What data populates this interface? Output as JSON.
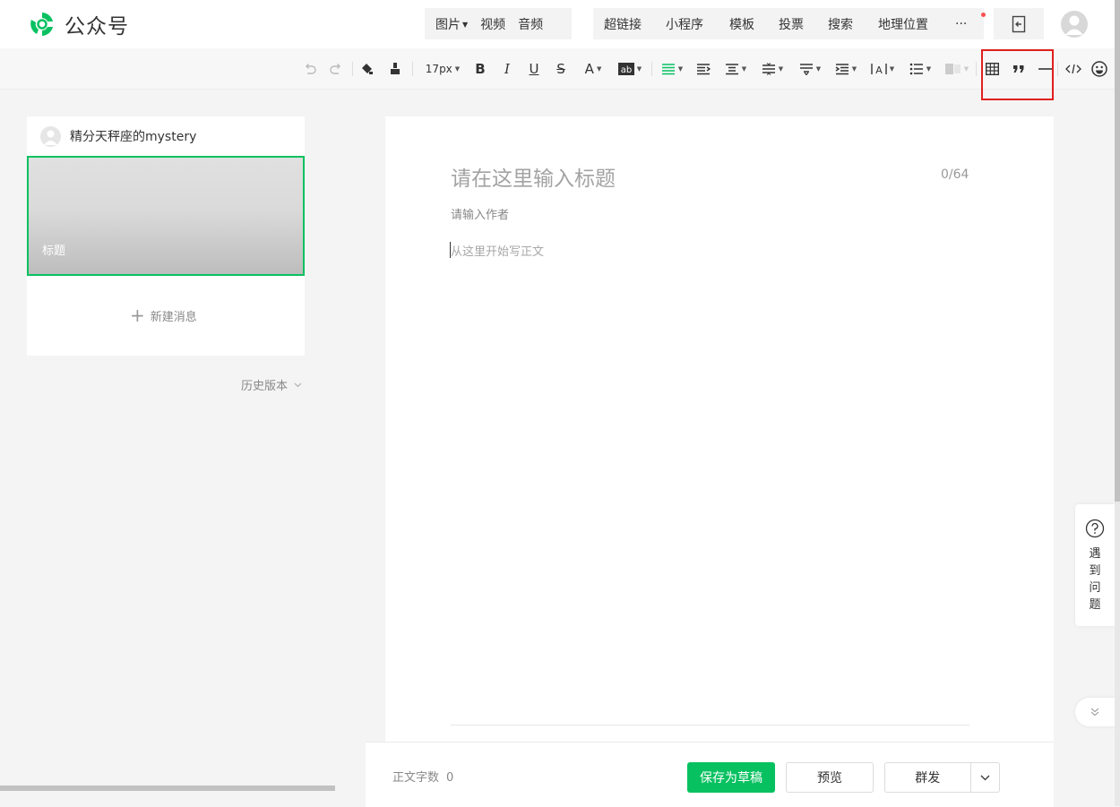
{
  "app": {
    "name": "公众号",
    "brand_color": "#07c160"
  },
  "insert_menu": {
    "group1": [
      {
        "label": "图片",
        "has_dropdown": true
      },
      {
        "label": "视频"
      },
      {
        "label": "音频"
      }
    ],
    "group2": [
      {
        "label": "超链接"
      },
      {
        "label": "小程序"
      },
      {
        "label": "模板"
      },
      {
        "label": "投票"
      },
      {
        "label": "搜索"
      },
      {
        "label": "地理位置"
      }
    ],
    "more_label": "···"
  },
  "toolbar": {
    "font_size": "17px",
    "buttons": [
      "undo-icon",
      "redo-icon",
      "format-painter-icon",
      "clear-format-icon",
      "font-size-select",
      "bold-icon",
      "italic-icon",
      "underline-icon",
      "strikethrough-icon",
      "font-color-icon",
      "background-color-icon",
      "align-icon",
      "indent-icon",
      "justify-icon",
      "line-height-icon",
      "paragraph-spacing-icon",
      "text-indent-icon",
      "letter-spacing-icon",
      "list-icon",
      "image-float-icon",
      "table-icon",
      "quote-icon",
      "divider-icon",
      "code-icon",
      "emoji-icon"
    ]
  },
  "left_panel": {
    "account_name": "精分天秤座的mystery",
    "cover_title": "标题",
    "new_message_label": "新建消息",
    "history_label": "历史版本"
  },
  "editor": {
    "title_placeholder": "请在这里输入标题",
    "title_count": "0/64",
    "author_placeholder": "请输入作者",
    "body_placeholder": "从这里开始写正文"
  },
  "footer": {
    "word_count_label": "正文字数",
    "word_count_value": "0",
    "save_label": "保存为草稿",
    "preview_label": "预览",
    "mass_send_label": "群发"
  },
  "help": {
    "label": "遇到问题"
  }
}
